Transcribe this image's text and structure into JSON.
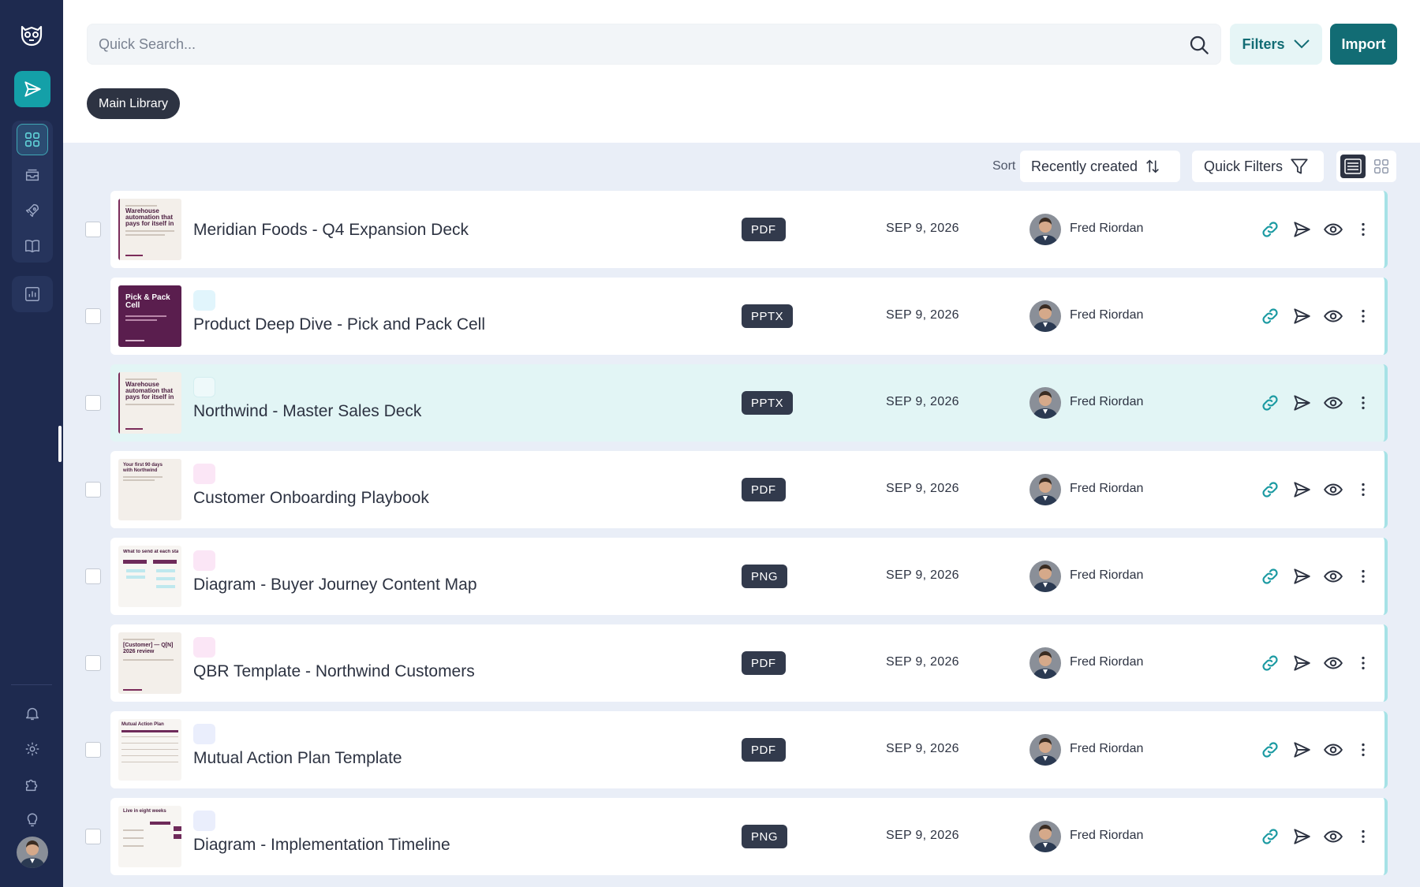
{
  "search": {
    "placeholder": "Quick Search..."
  },
  "header": {
    "filters_label": "Filters",
    "import_label": "Import"
  },
  "library": {
    "active_label": "Main Library"
  },
  "toolbar": {
    "sort_label": "Sort",
    "sort_value": "Recently created",
    "quick_filters_label": "Quick Filters"
  },
  "colors": {
    "accent": "#126c74",
    "sidebar": "#1e2a4f",
    "badge": "#323a4c",
    "selected_row": "#e2f5f5"
  },
  "thumbnails": {
    "meridian": {
      "heading": "Warehouse automation that pays for itself in one season."
    },
    "pick": {
      "heading": "Pick & Pack Cell"
    },
    "northwind": {
      "heading": "Warehouse automation that pays for itself in one season."
    },
    "onboarding": {
      "heading": "Your first 90 days with Northwind"
    },
    "journey": {
      "heading": "What to send at each stage"
    },
    "qbr": {
      "heading": "[Customer] — Q[N] 2026 review"
    },
    "map": {
      "heading": "Mutual Action Plan"
    },
    "timeline": {
      "heading": "Live in eight weeks"
    }
  },
  "rows": [
    {
      "title": "Meridian Foods - Q4 Expansion Deck",
      "type": "PDF",
      "date": "SEP 9, 2026",
      "owner": "Fred Riordan"
    },
    {
      "title": "Product Deep Dive - Pick and Pack Cell",
      "type": "PPTX",
      "date": "SEP 9, 2026",
      "owner": "Fred Riordan"
    },
    {
      "title": "Northwind - Master Sales Deck",
      "type": "PPTX",
      "date": "SEP 9, 2026",
      "owner": "Fred Riordan"
    },
    {
      "title": "Customer Onboarding Playbook",
      "type": "PDF",
      "date": "SEP 9, 2026",
      "owner": "Fred Riordan"
    },
    {
      "title": "Diagram - Buyer Journey Content Map",
      "type": "PNG",
      "date": "SEP 9, 2026",
      "owner": "Fred Riordan"
    },
    {
      "title": "QBR Template - Northwind Customers",
      "type": "PDF",
      "date": "SEP 9, 2026",
      "owner": "Fred Riordan"
    },
    {
      "title": "Mutual Action Plan Template",
      "type": "PDF",
      "date": "SEP 9, 2026",
      "owner": "Fred Riordan"
    },
    {
      "title": "Diagram - Implementation Timeline",
      "type": "PNG",
      "date": "SEP 9, 2026",
      "owner": "Fred Riordan"
    }
  ]
}
